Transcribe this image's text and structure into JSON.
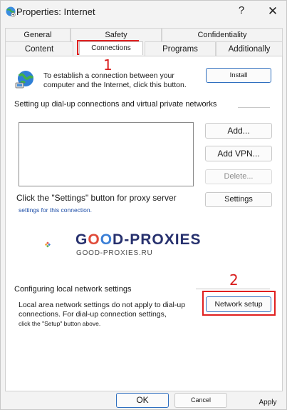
{
  "window": {
    "title": "Properties: Internet",
    "help_glyph": "?",
    "close_glyph": "✕"
  },
  "tabs": {
    "row1": [
      "General",
      "Safety",
      "Confidentiality"
    ],
    "row2": [
      "Content",
      "Connections",
      "Programs",
      "Additionally"
    ],
    "active": "Connections"
  },
  "intro": {
    "text": "To establish a connection between your computer and the Internet, click this button.",
    "install_label": "Install"
  },
  "dialup": {
    "heading": "Setting up dial-up connections and virtual private networks",
    "add_label": "Add...",
    "add_vpn_label": "Add VPN...",
    "delete_label": "Delete...",
    "settings_label": "Settings"
  },
  "proxy": {
    "text": "Click the \"Settings\" button for proxy server",
    "subtext": "settings for this connection."
  },
  "watermark": {
    "brand_part1": "G",
    "brand_o1": "O",
    "brand_o2": "O",
    "brand_part2": "D-PROXIES",
    "url": "GOOD-PROXIES.RU"
  },
  "lan": {
    "heading": "Configuring local network settings",
    "text": "Local area network settings do not apply to dial-up connections. For dial-up connection settings,",
    "subtext": "click the \"Setup\" button above.",
    "network_setup_label": "Network setup"
  },
  "annotations": {
    "marker1": "1",
    "marker2": "2",
    "color": "#e02020"
  },
  "footer": {
    "ok_label": "OK",
    "cancel_label": "Cancel",
    "apply_label": "Apply"
  },
  "icons": {
    "title": "internet-globe-icon",
    "intro": "globe-network-icon",
    "logo": "good-proxies-logo-icon"
  }
}
